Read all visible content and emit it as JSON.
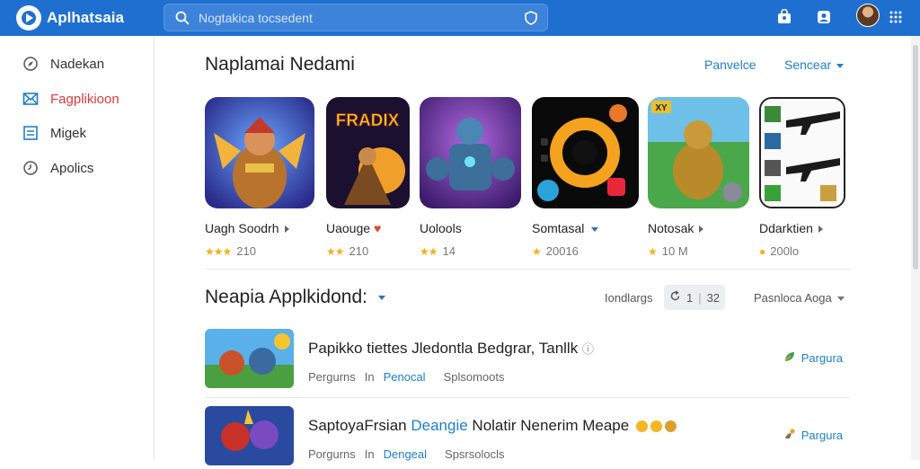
{
  "header": {
    "app_title": "Aplhatsaia",
    "search_placeholder": "Nogtakica tocsedent",
    "icons": [
      "search-icon",
      "shield-icon",
      "bag-icon",
      "user-icon",
      "grid-icon"
    ],
    "brand_color": "#1f6fd1"
  },
  "sidebar": {
    "items": [
      {
        "label": "Nadekan",
        "icon": "compass-icon",
        "active": false
      },
      {
        "label": "Fagplikioon",
        "icon": "mail-icon",
        "active": true
      },
      {
        "label": "Migek",
        "icon": "document-icon",
        "active": false
      },
      {
        "label": "Apolics",
        "icon": "clock-icon",
        "active": false
      }
    ],
    "active_color": "#d83a3a"
  },
  "featured": {
    "title": "Naplamai Nedami",
    "see_all_label": "Panvelce",
    "sort_label": "Sencear",
    "cards": [
      {
        "name": "Uagh Soodrh",
        "rating": "210",
        "thumb": "hero-warrior-art"
      },
      {
        "name": "Uaouge",
        "rating": "210",
        "thumb": "fradix-game-art",
        "art_text": "FRADIX"
      },
      {
        "name": "Uolools",
        "rating": "14",
        "thumb": "armored-robot-art"
      },
      {
        "name": "Somtasal",
        "rating": "20016",
        "thumb": "ring-app-art"
      },
      {
        "name": "Notosak",
        "rating": "10 M",
        "thumb": "golden-knight-art",
        "art_text": "XY"
      },
      {
        "name": "Ddarktien",
        "rating": "200lo",
        "thumb": "weapons-grid-art"
      }
    ]
  },
  "list_section": {
    "title": "Neapia Applkidond:",
    "count_label": "Iondlargs",
    "sort_pill": {
      "value": "1",
      "suffix": "32"
    },
    "filter_label": "Pasnloca Aoga",
    "rows": [
      {
        "title": "Papikko tiettes Jledontla Bedgrar, Tanllk",
        "title_highlight": "",
        "title_suffix": "",
        "meta": [
          "Pergurns",
          "In",
          "Penocal",
          "Splsomoots"
        ],
        "action": "Pargura"
      },
      {
        "title": "SaptoyaFrsian",
        "title_highlight": "Deangie",
        "title_suffix": "Nolatir Nenerim Meape",
        "meta": [
          "Porgurns",
          "In",
          "Dengeal",
          "Spsrsolocls"
        ],
        "action": "Pargura"
      }
    ]
  }
}
